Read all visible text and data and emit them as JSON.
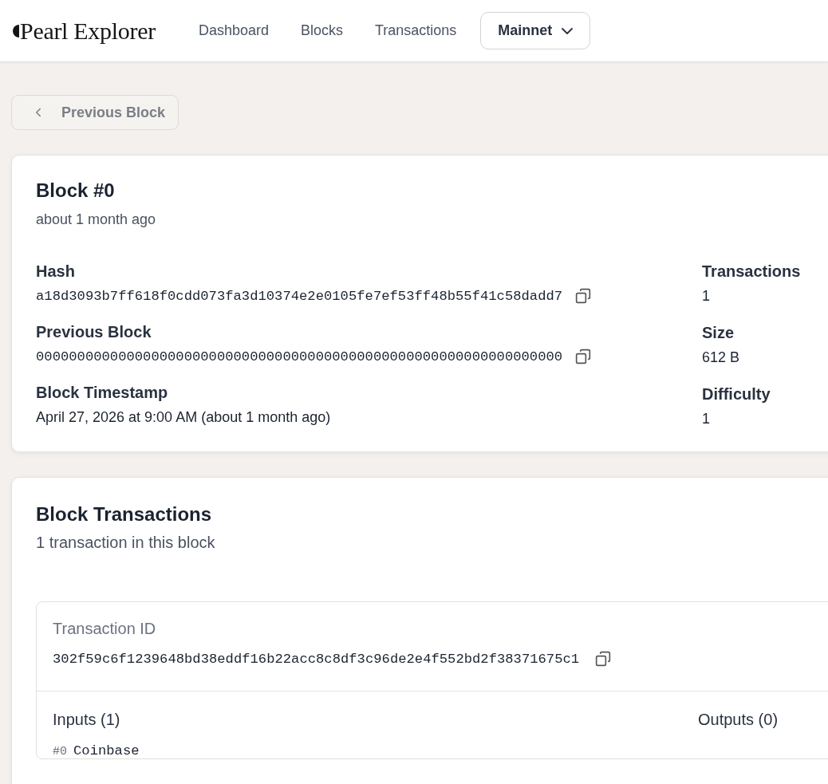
{
  "header": {
    "logo": "Pearl Explorer",
    "nav": [
      {
        "label": "Dashboard"
      },
      {
        "label": "Blocks"
      },
      {
        "label": "Transactions"
      }
    ],
    "network": "Mainnet"
  },
  "back_button": "Previous Block",
  "block": {
    "title": "Block #0",
    "subtitle": "about 1 month ago",
    "left_fields": [
      {
        "label": "Hash",
        "value": "a18d3093b7ff618f0cdd073fa3d10374e2e0105fe7ef53ff48b55f41c58dadd7",
        "kind": "hash"
      },
      {
        "label": "Previous Block",
        "value": "0000000000000000000000000000000000000000000000000000000000000000",
        "kind": "hash"
      },
      {
        "label": "Block Timestamp",
        "value": "April 27, 2026 at 9:00 AM (about 1 month ago)",
        "kind": "text"
      }
    ],
    "right_fields": [
      {
        "label": "Transactions",
        "value": "1"
      },
      {
        "label": "Size",
        "value": "612 B"
      },
      {
        "label": "Difficulty",
        "value": "1"
      }
    ]
  },
  "transactions": {
    "title": "Block Transactions",
    "subtitle": "1 transaction in this block",
    "items": [
      {
        "id_label": "Transaction ID",
        "id": "302f59c6f1239648bd38eddf16b22acc8c8df3c96de2e4f552bd2f38371675c1",
        "inputs_label": "Inputs (1)",
        "outputs_label": "Outputs (0)",
        "inputs": [
          {
            "index": "#0",
            "value": "Coinbase"
          }
        ]
      }
    ]
  }
}
